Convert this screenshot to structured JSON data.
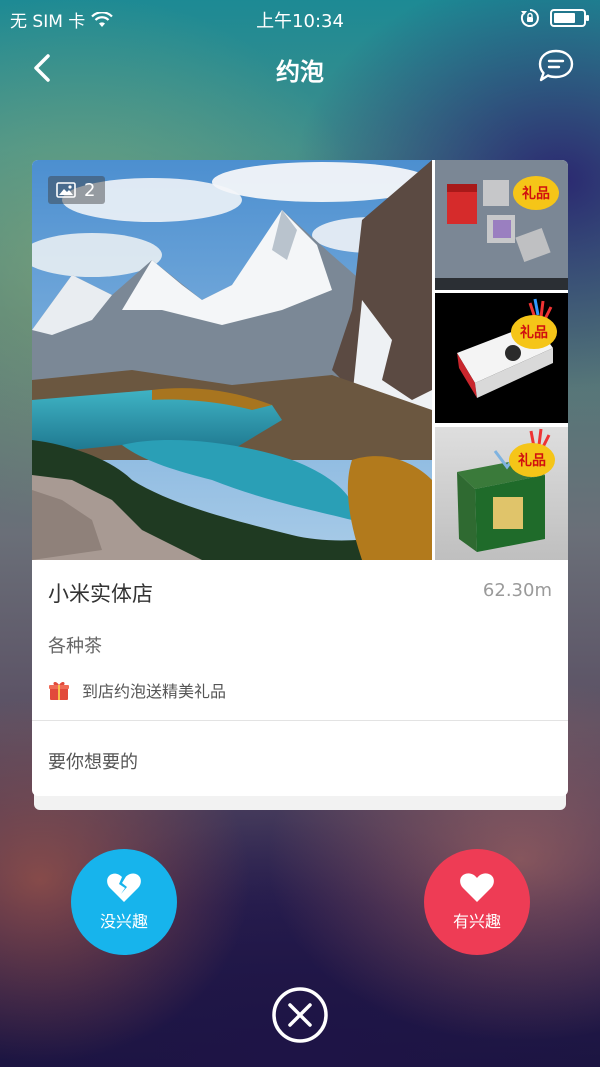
{
  "status_bar": {
    "carrier": "无 SIM 卡",
    "time": "上午10:34",
    "battery_level": 0.75
  },
  "nav": {
    "title": "约泡",
    "back_icon": "chevron-left-icon",
    "chat_icon": "chat-bubble-icon"
  },
  "card": {
    "photo_count": "2",
    "gift_badge_text": "礼品",
    "shop_name": "小米实体店",
    "distance": "62.30m",
    "category": "各种茶",
    "promo_text": "到店约泡送精美礼品",
    "wish_text": "要你想要的"
  },
  "actions": {
    "dislike_label": "没兴趣",
    "like_label": "有兴趣",
    "dislike_icon": "broken-heart-icon",
    "like_icon": "heart-icon",
    "close_icon": "close-circle-icon"
  },
  "colors": {
    "dislike": "#17b4ec",
    "like": "#ee3c55",
    "gift": "#e24a3b"
  }
}
